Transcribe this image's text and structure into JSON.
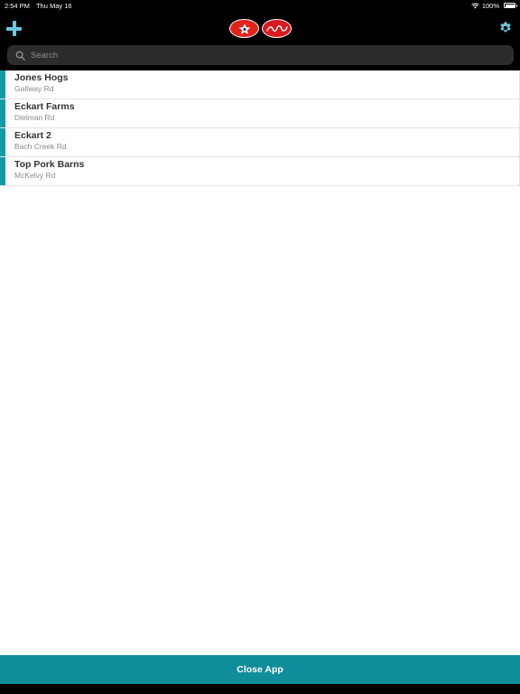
{
  "status_bar": {
    "time": "2:54 PM",
    "date": "Thu May 16",
    "battery": "100%",
    "battery_level": 1.0
  },
  "nav": {
    "add_icon": "plus-icon",
    "settings_icon": "gear-icon",
    "accent_color": "#6ec5df"
  },
  "search": {
    "placeholder": "Search",
    "value": ""
  },
  "farms": [
    {
      "name": "Jones Hogs",
      "road": "Gallway Rd"
    },
    {
      "name": "Eckart Farms",
      "road": "Dielman Rd"
    },
    {
      "name": "Eckart 2",
      "road": "Bach Creek Rd"
    },
    {
      "name": "Top Pork Barns",
      "road": "McKelvy Rd"
    }
  ],
  "footer": {
    "close_label": "Close App",
    "color": "#0f8d9b"
  },
  "colors": {
    "row_accent": "#129aa8",
    "logo_red": "#e2231a"
  }
}
